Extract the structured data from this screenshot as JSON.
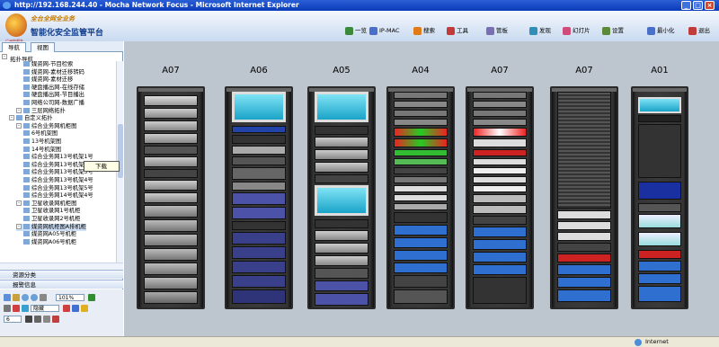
{
  "window": {
    "title": "http://192.168.244.40 - Mocha Network Focus - Microsoft Internet Explorer"
  },
  "header": {
    "logo_text": "广州电视台",
    "subtitle": "全台全网全业务",
    "app_title": "智能化安全监管平台"
  },
  "toolbar": {
    "items": [
      {
        "label": "一览",
        "icon": "overview-icon",
        "color": "#3b8a3b"
      },
      {
        "label": "IP-MAC",
        "icon": "ip-mac-icon",
        "color": "#4a6fc9"
      },
      {
        "label": "搜索",
        "icon": "search-icon",
        "color": "#e07b18"
      },
      {
        "label": "工具",
        "icon": "tools-icon",
        "color": "#c23b3b"
      },
      {
        "label": "管板",
        "icon": "panel-icon",
        "color": "#7a6fb5"
      },
      {
        "label": "发现",
        "icon": "discover-icon",
        "color": "#2f8fb8"
      },
      {
        "label": "幻灯片",
        "icon": "slideshow-icon",
        "color": "#d04a7a"
      },
      {
        "label": "设置",
        "icon": "settings-icon",
        "color": "#5a8a3a"
      },
      {
        "label": "最小化",
        "icon": "minimize-icon",
        "color": "#4a6fc9"
      },
      {
        "label": "退出",
        "icon": "exit-icon",
        "color": "#c23b3b"
      }
    ]
  },
  "left": {
    "tabs": [
      "导航",
      "视图"
    ],
    "tree_header": "拓扑导航",
    "tree": [
      {
        "label": "媒资网-节目检索",
        "level": 3
      },
      {
        "label": "媒资网-素材迁移转码",
        "level": 3
      },
      {
        "label": "媒资网-素材迁移",
        "level": 3
      },
      {
        "label": "硬盘播出网-在线存储",
        "level": 3
      },
      {
        "label": "硬盘播出网-节目播出",
        "level": 3
      },
      {
        "label": "网络公司网-数据广播",
        "level": 3
      },
      {
        "label": "三层网络拓扑",
        "level": 2
      },
      {
        "label": "自定义拓扑",
        "level": 1
      },
      {
        "label": "综合业务网机柜图",
        "level": 2
      },
      {
        "label": "6号机架图",
        "level": 3
      },
      {
        "label": "13号机架图",
        "level": 3
      },
      {
        "label": "14号机架图",
        "level": 3
      },
      {
        "label": "综合业务网13号机架1号",
        "level": 3
      },
      {
        "label": "综合业务网13号机架2号",
        "level": 3
      },
      {
        "label": "综合业务网13号机架3号",
        "level": 3
      },
      {
        "label": "综合业务网13号机架4号",
        "level": 3
      },
      {
        "label": "综合业务网13号机架5号",
        "level": 3
      },
      {
        "label": "综合业务网14号机架4号",
        "level": 3
      },
      {
        "label": "卫星收录网机柜图",
        "level": 2
      },
      {
        "label": "卫星收录网1号机柜",
        "level": 3
      },
      {
        "label": "卫星收录网2号机柜",
        "level": 3
      },
      {
        "label": "媒资网机柜图A排机柜",
        "level": 2
      },
      {
        "label": "媒资网A05号机柜",
        "level": 3
      },
      {
        "label": "媒资网A06号机柜",
        "level": 3
      }
    ],
    "popup": "下载",
    "panel_resource": "资源分类",
    "panel_alarm": "报警信息",
    "zoom_value": "101%",
    "line_style": "隐藏",
    "font_size": "6"
  },
  "racks": [
    {
      "label": "A07",
      "kind": "servers"
    },
    {
      "label": "A06",
      "kind": "monitor-mixed"
    },
    {
      "label": "A05",
      "kind": "monitor-servers"
    },
    {
      "label": "A04",
      "kind": "network"
    },
    {
      "label": "A07",
      "kind": "network2"
    },
    {
      "label": "A07",
      "kind": "storage"
    },
    {
      "label": "A01",
      "kind": "mixed"
    }
  ],
  "status": {
    "zone": "Internet"
  }
}
